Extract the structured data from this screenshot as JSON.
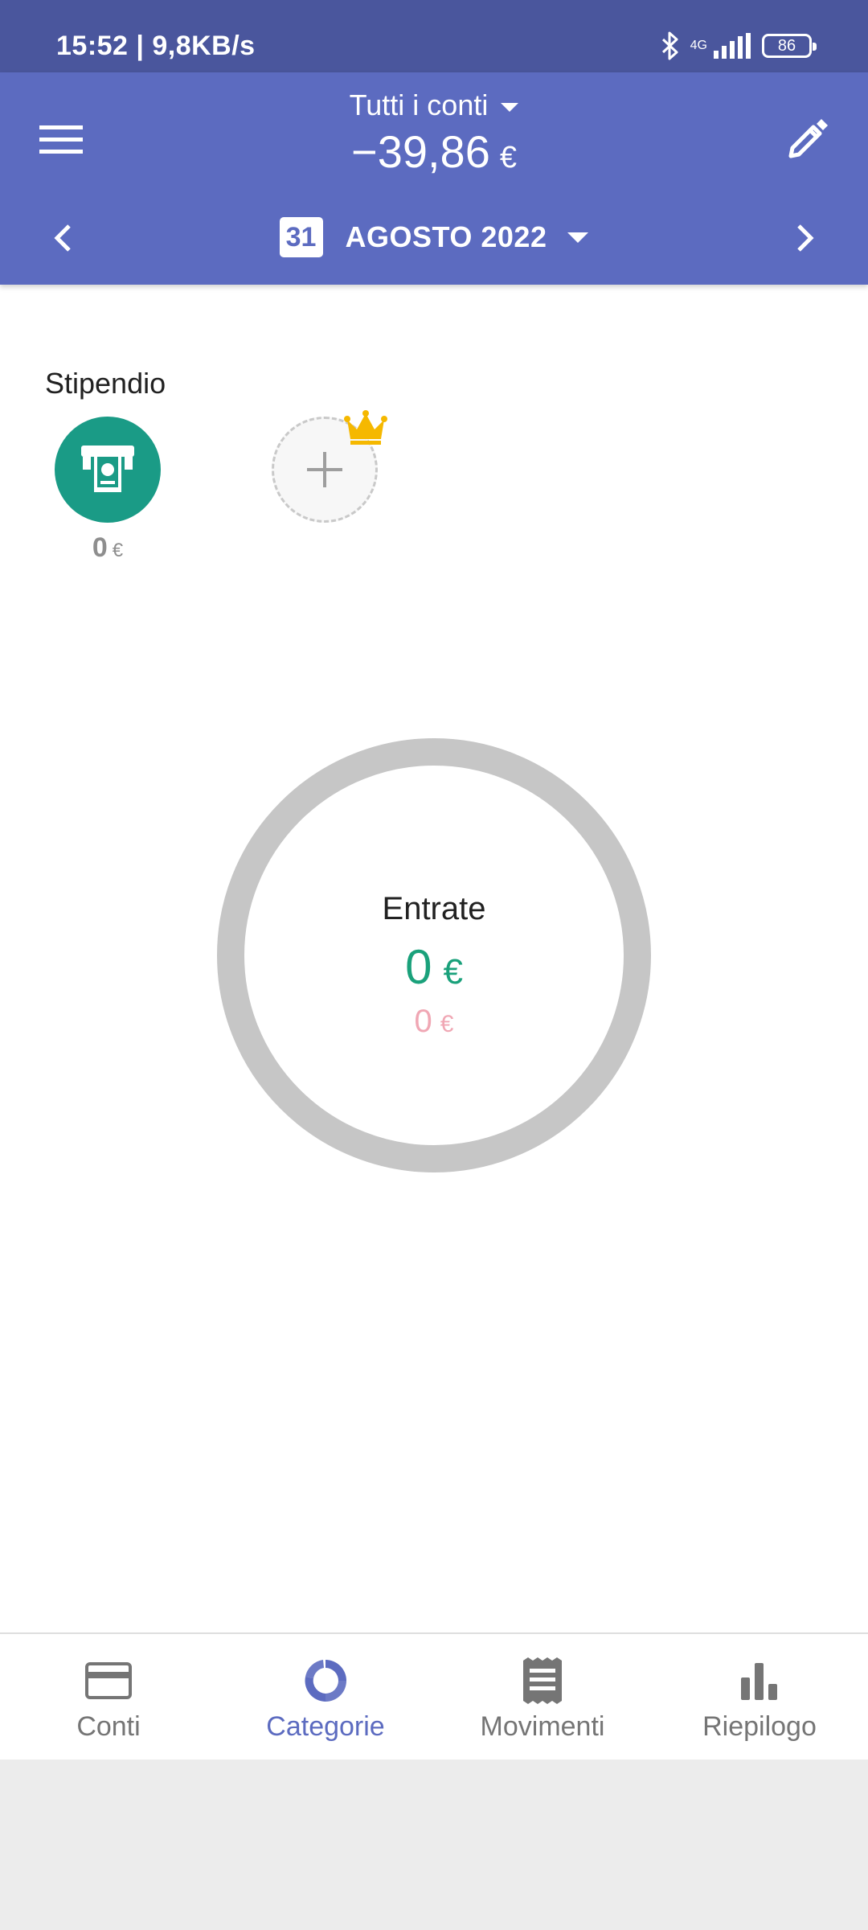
{
  "status_bar": {
    "time": "15:52 | 9,8KB/s",
    "network": "4G",
    "battery": "86"
  },
  "header": {
    "account_selector": "Tutti i conti",
    "balance_value": "−39,86",
    "balance_currency": "€",
    "calendar_day": "31",
    "period": "AGOSTO 2022"
  },
  "categories": [
    {
      "name": "Stipendio",
      "amount": "0",
      "currency": "€",
      "color": "#1a9b86",
      "icon": "atm-cash-icon"
    }
  ],
  "add_category": {
    "icon": "plus-icon",
    "badge_icon": "crown-icon"
  },
  "summary": {
    "title": "Entrate",
    "value": "0",
    "currency": "€",
    "secondary_value": "0",
    "secondary_currency": "€"
  },
  "bottom_nav": {
    "tabs": [
      {
        "label": "Conti",
        "icon": "credit-card-icon",
        "active": false
      },
      {
        "label": "Categorie",
        "icon": "donut-chart-icon",
        "active": true
      },
      {
        "label": "Movimenti",
        "icon": "receipt-icon",
        "active": false
      },
      {
        "label": "Riepilogo",
        "icon": "bar-chart-icon",
        "active": false
      }
    ]
  },
  "colors": {
    "primary": "#5c6bc0",
    "status_bar": "#4a569d",
    "income_green": "#1aa17b",
    "expense_pink": "#f0a7b4",
    "category_teal": "#1a9b86",
    "donut_empty": "#c6c6c6",
    "crown": "#f5b800"
  }
}
